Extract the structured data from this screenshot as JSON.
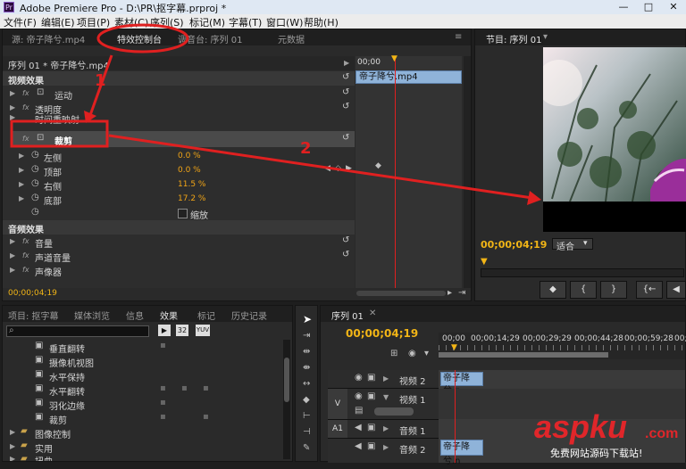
{
  "window": {
    "title": "Adobe Premiere Pro - D:\\PR\\抠字幕.prproj *",
    "app_icon": "Pr",
    "min": "—",
    "max": "□",
    "close": "✕"
  },
  "menu": [
    "文件(F)",
    "编辑(E)",
    "项目(P)",
    "素材(C)",
    "序列(S)",
    "标记(M)",
    "字幕(T)",
    "窗口(W)",
    "帮助(H)"
  ],
  "source_tabs": [
    "源: 帝子降兮.mp4",
    "特效控制台",
    "调音台: 序列 01",
    "元数据"
  ],
  "effect_controls": {
    "clip_path": "序列 01 * 帝子降兮.mp4",
    "clip_name": "帝子降兮.mp4",
    "time_start": "00;00",
    "video_section": "视频效果",
    "effects": [
      "运动",
      "透明度",
      "时间重映射",
      "裁剪"
    ],
    "crop_params": [
      {
        "label": "左侧",
        "value": "0.0 %"
      },
      {
        "label": "顶部",
        "value": "0.0 %"
      },
      {
        "label": "右侧",
        "value": "11.5 %"
      },
      {
        "label": "底部",
        "value": "17.2 %"
      }
    ],
    "zoom_label": "缩放",
    "audio_section": "音频效果",
    "audio_effects": [
      "音量",
      "声道音量",
      "声像器"
    ],
    "timecode": "00;00;04;19"
  },
  "program": {
    "tab": "节目: 序列 01",
    "timecode": "00;00;04;19",
    "fit": "适合"
  },
  "project_tabs": [
    "项目: 抠字幕",
    "媒体浏览",
    "信息",
    "效果",
    "标记",
    "历史记录"
  ],
  "effects_list": {
    "icons": [
      "32",
      "YUV"
    ],
    "items": [
      "垂直翻转",
      "摄像机视图",
      "水平保持",
      "水平翻转",
      "羽化边缘",
      "裁剪"
    ],
    "folders": [
      "图像控制",
      "实用",
      "扭曲"
    ]
  },
  "timeline": {
    "tab": "序列 01",
    "timecode": "00;00;04;19",
    "ruler": [
      "00;00",
      "00;00;14;29",
      "00;00;29;29",
      "00;00;44;28",
      "00;00;59;28",
      "00;01;"
    ],
    "tracks": [
      {
        "name": "视频 2"
      },
      {
        "name": "视频 1",
        "label": "V"
      },
      {
        "name": "音频 1",
        "label": "A1"
      },
      {
        "name": "音频 2"
      }
    ],
    "clip_label": "帝子降兮.n"
  },
  "annotations": {
    "n1": "1",
    "n2": "2"
  },
  "watermark": {
    "brand": "aspku",
    "tld": ".com",
    "sub": "免费网站源码下载站!"
  }
}
